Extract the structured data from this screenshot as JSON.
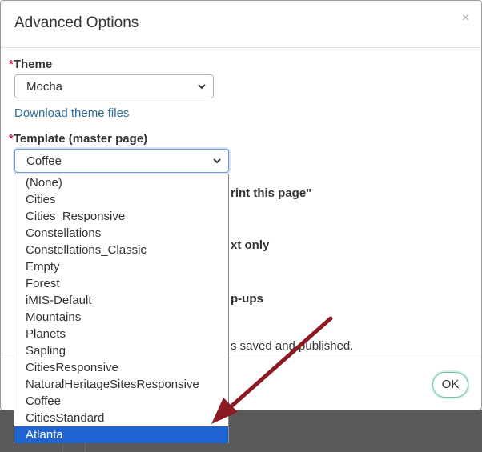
{
  "dialog": {
    "title": "Advanced Options",
    "close_label": "×"
  },
  "theme": {
    "required_marker": "*",
    "label": "Theme",
    "selected": "Mocha",
    "download_link": "Download theme files"
  },
  "template": {
    "required_marker": "*",
    "label": "Template (master page)",
    "selected": "Coffee",
    "options": [
      "(None)",
      "Cities",
      "Cities_Responsive",
      "Constellations",
      "Constellations_Classic",
      "Empty",
      "Forest",
      "iMIS-Default",
      "Mountains",
      "Planets",
      "Sapling",
      "CitiesResponsive",
      "NaturalHeritageSitesResponsive",
      "Coffee",
      "CitiesStandard",
      "Atlanta"
    ],
    "highlighted": "Atlanta"
  },
  "obscured": {
    "print_text": "rint this page\"",
    "text_only": "xt only",
    "popups": "p-ups",
    "saved_note": "s saved and published."
  },
  "footer": {
    "ok_label": "OK"
  },
  "colors": {
    "annotation_arrow": "#8b1a22",
    "selected_option": "#1e63d0"
  }
}
